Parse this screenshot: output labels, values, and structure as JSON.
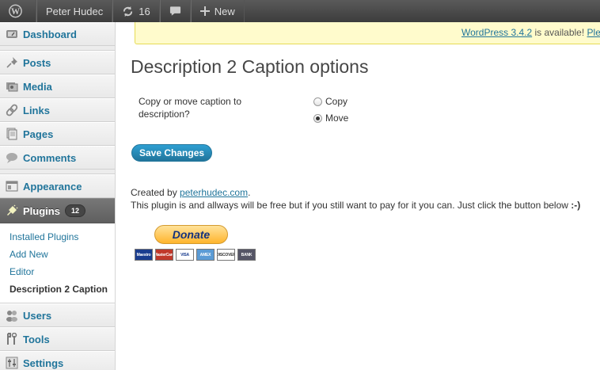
{
  "adminbar": {
    "user": "Peter Hudec",
    "updates_count": "16",
    "new_label": "New"
  },
  "sidebar": {
    "items": [
      {
        "label": "Dashboard",
        "icon": "dashboard-icon"
      },
      {
        "label": "Posts",
        "icon": "pin-icon"
      },
      {
        "label": "Media",
        "icon": "media-icon"
      },
      {
        "label": "Links",
        "icon": "link-icon"
      },
      {
        "label": "Pages",
        "icon": "pages-icon"
      },
      {
        "label": "Comments",
        "icon": "comments-icon"
      },
      {
        "label": "Appearance",
        "icon": "appearance-icon"
      },
      {
        "label": "Plugins",
        "icon": "plugin-icon",
        "badge": "12"
      },
      {
        "label": "Users",
        "icon": "users-icon"
      },
      {
        "label": "Tools",
        "icon": "tools-icon"
      },
      {
        "label": "Settings",
        "icon": "settings-icon"
      }
    ],
    "plugins_submenu": [
      "Installed Plugins",
      "Add New",
      "Editor",
      "Description 2 Caption"
    ]
  },
  "update_nag": {
    "link_text": "WordPress 3.4.2",
    "text": " is available! ",
    "link2_text": "Ple"
  },
  "main": {
    "title": "Description 2 Caption options",
    "field_label": "Copy or move caption to description?",
    "options": [
      {
        "label": "Copy",
        "checked": false
      },
      {
        "label": "Move",
        "checked": true
      }
    ],
    "save_label": "Save Changes",
    "created_prefix": "Created by ",
    "created_link": "peterhudec.com",
    "created_suffix": ".",
    "free_text": "This plugin is and allways will be free but if you still want to pay for it you can. Just click the button below ",
    "free_smiley": ":-)",
    "donate_label": "Donate",
    "cards": [
      "Maestro",
      "MasterCard",
      "VISA",
      "AMEX",
      "DISCOVER",
      "BANK"
    ]
  },
  "colors": {
    "link": "#21759b",
    "current_menu_bg": "#5f5f5f",
    "nag_bg": "#fffbcc"
  }
}
